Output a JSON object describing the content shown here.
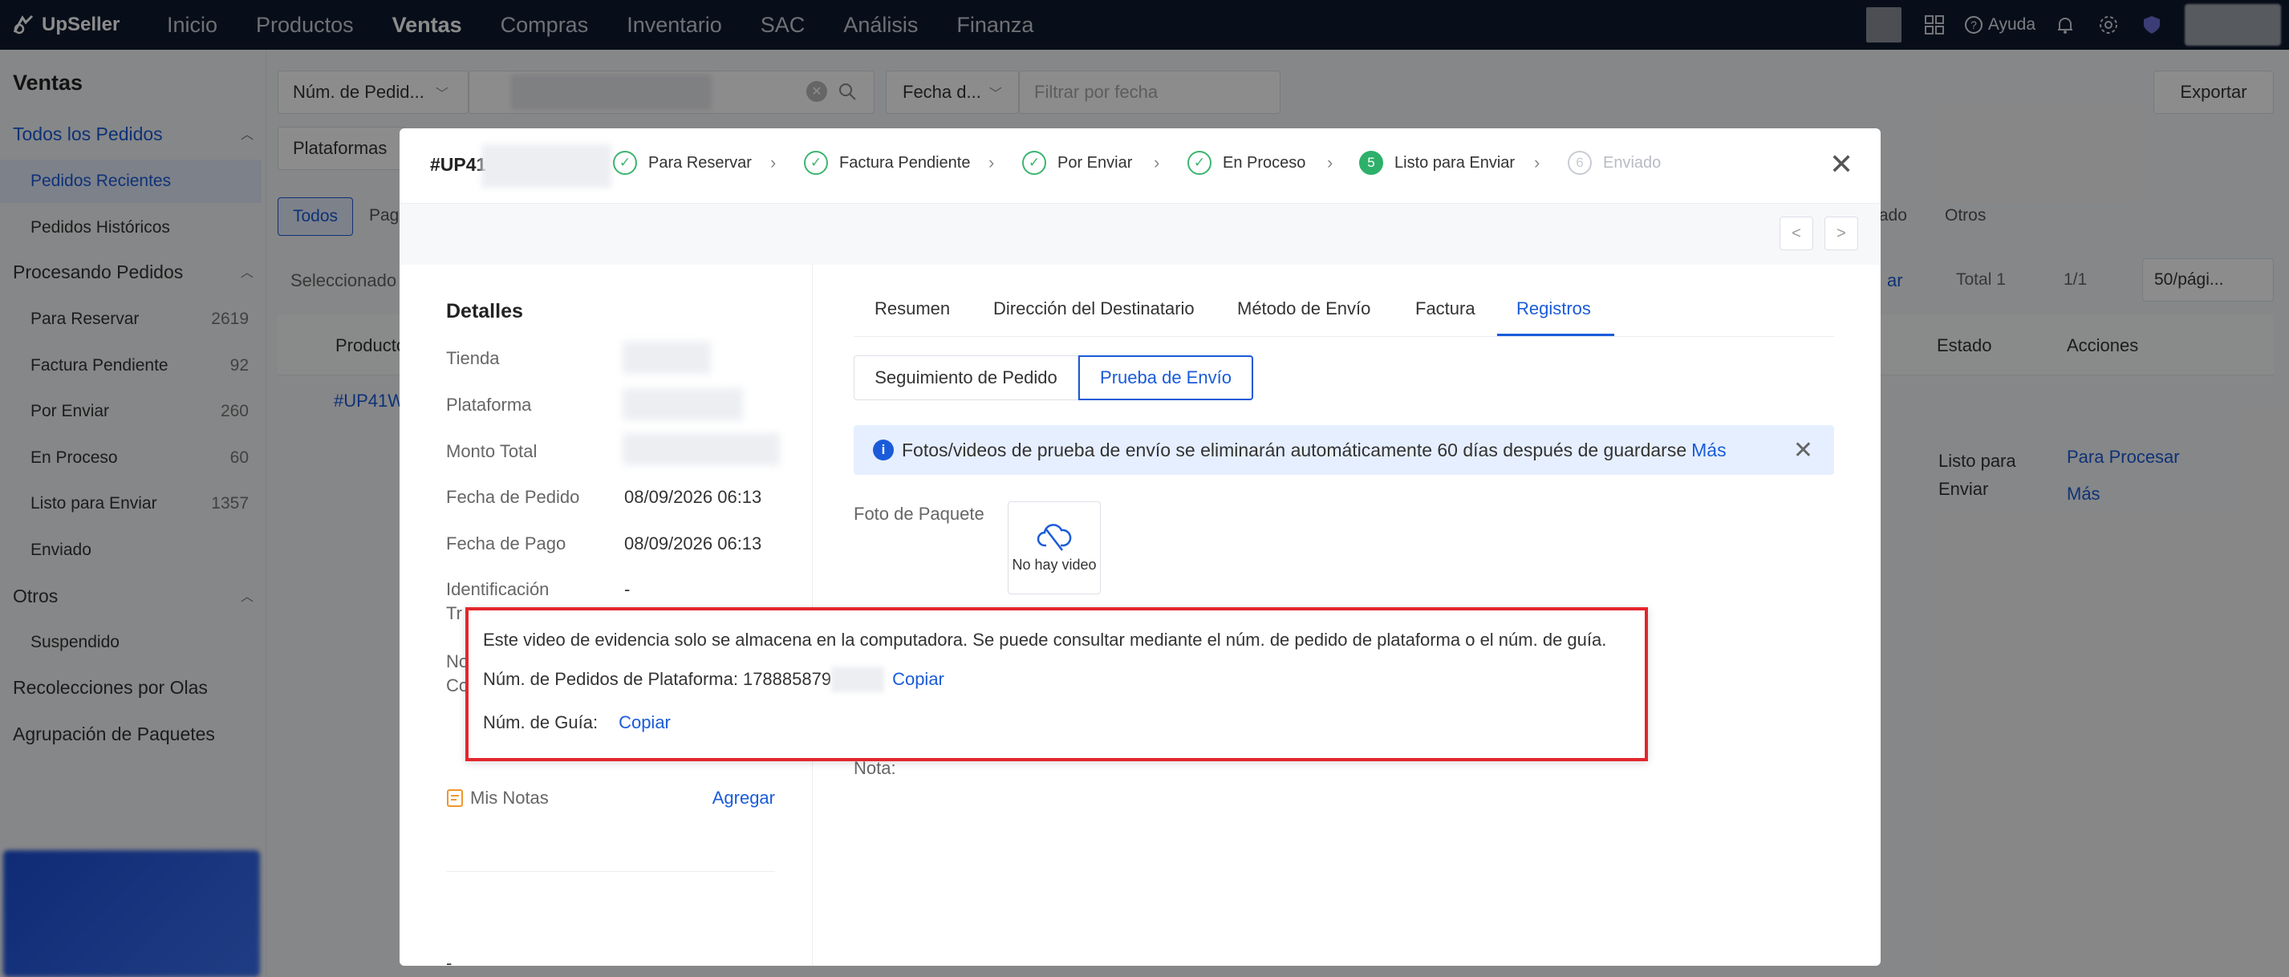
{
  "brand": "UpSeller",
  "nav": [
    "Inicio",
    "Productos",
    "Ventas",
    "Compras",
    "Inventario",
    "SAC",
    "Análisis",
    "Finanza"
  ],
  "nav_active": "Ventas",
  "help": "Ayuda",
  "sidebar": {
    "title": "Ventas",
    "all_orders": "Todos los Pedidos",
    "recent": "Pedidos Recientes",
    "history": "Pedidos Históricos",
    "processing": "Procesando Pedidos",
    "proc_items": [
      {
        "label": "Para Reservar",
        "count": "2619"
      },
      {
        "label": "Factura Pendiente",
        "count": "92"
      },
      {
        "label": "Por Enviar",
        "count": "260"
      },
      {
        "label": "En Proceso",
        "count": "60"
      },
      {
        "label": "Listo para Enviar",
        "count": "1357"
      },
      {
        "label": "Enviado",
        "count": ""
      }
    ],
    "others": "Otros",
    "suspended": "Suspendido",
    "waves": "Recolecciones por Olas",
    "grouping": "Agrupación de Paquetes"
  },
  "main": {
    "search_select": "Núm. de Pedid...",
    "date_select": "Fecha d...",
    "date_placeholder": "Filtrar por fecha",
    "export": "Exportar",
    "platforms": "Plataformas",
    "tab_all": "Todos",
    "tab_partial": "Pag",
    "tab_state": "tado",
    "tab_others": "Otros",
    "selected": "Seleccionado",
    "sort_partial": "ar",
    "total": "Total 1",
    "pager": "1/1",
    "per_page": "50/pági...",
    "col_product": "Producto",
    "col_state": "Estado",
    "col_actions": "Acciones",
    "order_link": "#UP41W",
    "row_state": "Listo para Enviar",
    "row_action": "Para Procesar",
    "row_more": "Más"
  },
  "modal": {
    "order_prefix": "#UP41",
    "steps": [
      {
        "label": "Para Reservar",
        "mark": "✓"
      },
      {
        "label": "Factura Pendiente",
        "mark": "✓"
      },
      {
        "label": "Por Enviar",
        "mark": "✓"
      },
      {
        "label": "En Proceso",
        "mark": "✓"
      },
      {
        "label": "Listo para Enviar",
        "mark": "5"
      },
      {
        "label": "Enviado",
        "mark": "6"
      }
    ],
    "prev": "<",
    "next": ">",
    "details_title": "Detalles",
    "fields": {
      "store": "Tienda",
      "platform": "Plataforma",
      "total": "Monto Total",
      "order_date": "Fecha de Pedido",
      "order_date_val": "08/09/2026 06:13",
      "pay_date": "Fecha de Pago",
      "pay_date_val": "08/09/2026 06:13",
      "ident": "Identificación",
      "ident_val": "-",
      "ident_cut": "Tr",
      "no_cut": "No",
      "co_cut": "Co"
    },
    "notes_label": "Mis Notas",
    "notes_add": "Agregar",
    "notes_val": "-",
    "tabs": [
      "Resumen",
      "Dirección del Destinatario",
      "Método de Envío",
      "Factura",
      "Registros"
    ],
    "seg_tracking": "Seguimiento de Pedido",
    "seg_proof": "Prueba de Envío",
    "info_text": "Fotos/videos de prueba de envío se eliminarán automáticamente 60 días después de guardarse",
    "info_more": "Más",
    "pkg_photo": "Foto de Paquete",
    "no_video": "No hay video",
    "nota": "Nota:",
    "popup": {
      "line1": "Este video de evidencia solo se almacena en la computadora. Se puede consultar mediante el núm. de pedido de plataforma o el núm. de guía.",
      "platform_label": "Núm. de Pedidos de Plataforma:",
      "platform_val": "178885879",
      "copy": "Copiar",
      "guide_label": "Núm. de Guía:",
      "copy2": "Copiar"
    }
  }
}
